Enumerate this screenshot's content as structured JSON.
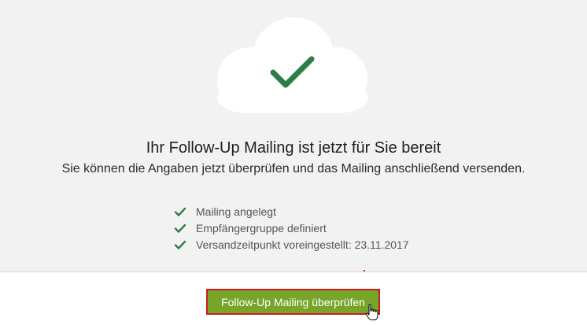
{
  "panel": {
    "title": "Ihr Follow-Up Mailing ist jetzt für Sie bereit",
    "subtitle": "Sie können die Angaben jetzt überprüfen und das Mailing anschließend versenden.",
    "checklist": [
      {
        "label": "Mailing angelegt"
      },
      {
        "label": "Empfängergruppe definiert"
      },
      {
        "label": "Versandzeitpunkt voreingestellt: 23.11.2017"
      }
    ]
  },
  "footer": {
    "review_button_label": "Follow-Up Mailing überprüfen"
  },
  "icons": {
    "hero": "cloud-check-icon",
    "list": "checkmark-icon",
    "cursor": "hand-pointer-icon"
  },
  "colors": {
    "check_green": "#2e7d48",
    "button_green": "#76a52a",
    "button_border": "#d0191f",
    "panel_background": "#f2f2f2"
  }
}
